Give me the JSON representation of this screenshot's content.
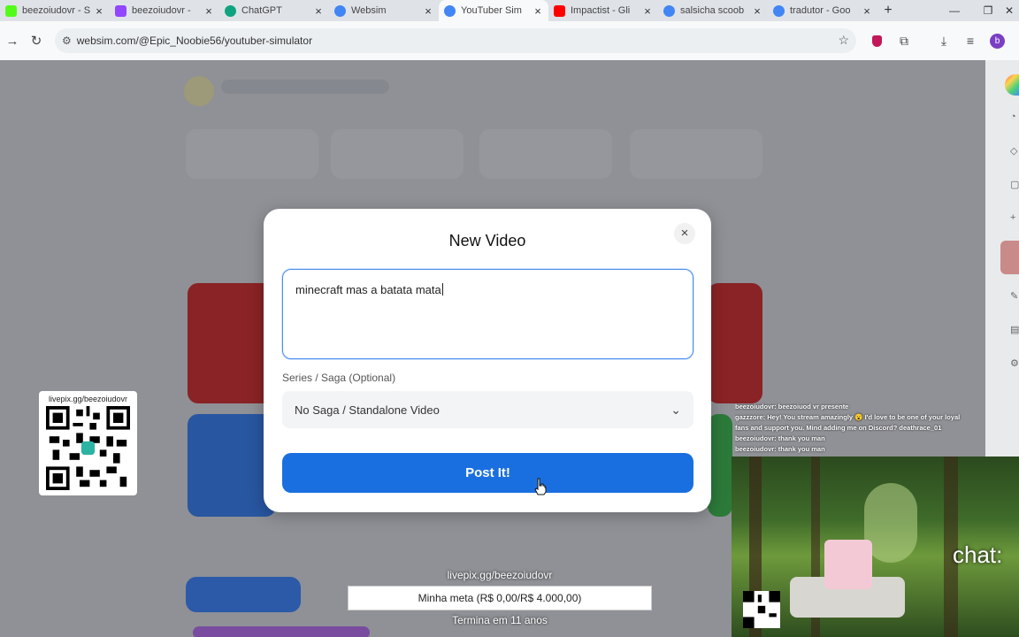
{
  "browser": {
    "tabs": [
      {
        "title": "beezoiudovr - S",
        "color": "#53fc18"
      },
      {
        "title": "beezoiudovr -",
        "color": "#9146ff"
      },
      {
        "title": "ChatGPT",
        "color": "#10a37f"
      },
      {
        "title": "Websim",
        "color": "#4285f4"
      },
      {
        "title": "YouTuber Sim",
        "color": "#4285f4",
        "active": true
      },
      {
        "title": "Impactist - Gli",
        "color": "#ff0000"
      },
      {
        "title": "salsicha scoob",
        "color": "#4285f4"
      },
      {
        "title": "tradutor - Goo",
        "color": "#4285f4"
      }
    ],
    "new_tab": "+",
    "url": "websim.com/@Epic_Noobie56/youtuber-simulator",
    "profile_initial": "b"
  },
  "modal": {
    "title": "New Video",
    "close_label": "×",
    "video_title_value": "minecraft mas a batata mata",
    "series_label": "Series / Saga (Optional)",
    "series_selected": "No Saga / Standalone Video",
    "post_button": "Post It!"
  },
  "overlay": {
    "qr_label": "livepix.gg/beezoiudovr",
    "chat_lines": [
      "beezoiudovr: beezoiuod vr presente",
      "gazzzore: Hey! You stream amazingly 😮 I'd love to be one of your loyal",
      "fans and support you. Mind adding me on Discord? deathrace_01",
      "beezoiudovr: thank you man",
      "beezoiudovr: thank you man"
    ],
    "chat_word": "chat:",
    "goal_link": "livepix.gg/beezoiudovr",
    "goal_text": "Minha meta (R$ 0,00/R$ 4.000,00)",
    "goal_end": "Termina em 11 anos"
  }
}
